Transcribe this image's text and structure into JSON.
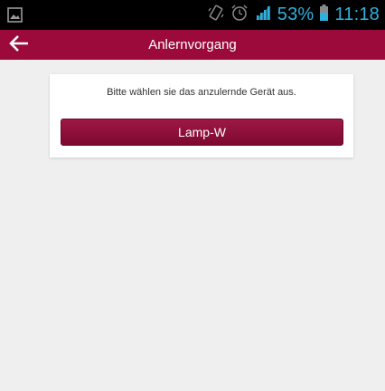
{
  "status_bar": {
    "battery_percent": "53%",
    "time": "11:18",
    "icons": [
      "image-icon",
      "vibrate-icon",
      "alarm-icon",
      "signal-icon",
      "battery-icon"
    ]
  },
  "app_bar": {
    "title": "Anlernvorgang",
    "back_icon": "arrow-left-icon"
  },
  "card": {
    "message": "Bitte wählen sie das anzulernde Gerät aus.",
    "device_button_label": "Lamp-W"
  },
  "colors": {
    "accent": "#9b0a3a",
    "status_icon": "#2fb1e0",
    "background": "#efefef"
  }
}
